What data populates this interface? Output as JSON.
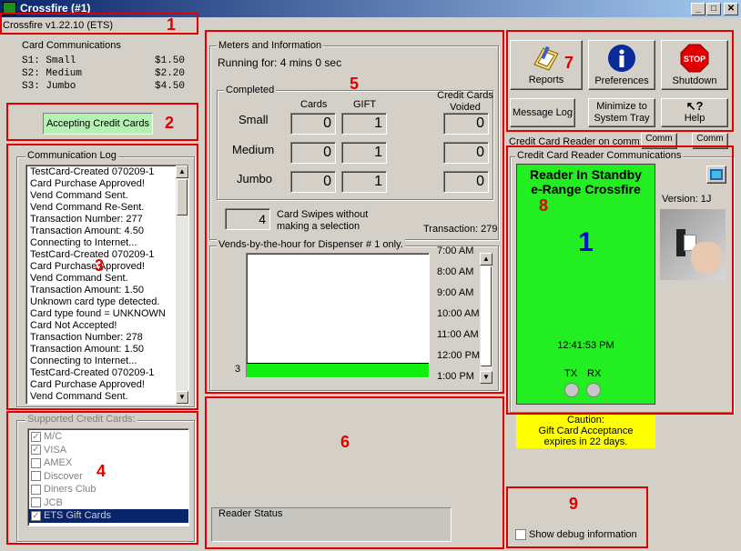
{
  "window": {
    "title": "Crossfire (#1)",
    "minimize": "_",
    "maximize": "□",
    "close": "✕"
  },
  "app_version": "Crossfire v1.22.10 (ETS)",
  "annotations": [
    "1",
    "2",
    "3",
    "4",
    "5",
    "6",
    "7",
    "8",
    "9"
  ],
  "card_comms": {
    "label": "Card Communications",
    "rows": [
      {
        "slot": "S1: Small",
        "price": "$1.50"
      },
      {
        "slot": "S2: Medium",
        "price": "$2.20"
      },
      {
        "slot": "S3: Jumbo",
        "price": "$4.50"
      }
    ]
  },
  "accepting_label": "Accepting Credit Cards",
  "comm_log": {
    "label": "Communication Log",
    "lines": [
      "TestCard-Created 070209-1",
      "Card Purchase Approved!",
      "Vend Command Sent.",
      "Vend Command Re-Sent.",
      "Transaction Number: 277",
      "Transaction Amount: 4.50",
      "Connecting to Internet...",
      "TestCard-Created 070209-1",
      "Card Purchase Approved!",
      "Vend Command Sent.",
      "Transaction Amount: 1.50",
      "Unknown card type detected.",
      "Card type found = UNKNOWN",
      "Card Not Accepted!",
      "Transaction Number: 278",
      "Transaction Amount: 1.50",
      "Connecting to Internet...",
      "TestCard-Created 070209-1",
      "Card Purchase Approved!",
      "Vend Command Sent."
    ]
  },
  "supported_cards": {
    "label": "Supported Credit Cards:",
    "items": [
      {
        "name": "M/C",
        "checked": "✓"
      },
      {
        "name": "VISA",
        "checked": "✓"
      },
      {
        "name": "AMEX",
        "checked": ""
      },
      {
        "name": "Discover",
        "checked": ""
      },
      {
        "name": "Diners Club",
        "checked": ""
      },
      {
        "name": "JCB",
        "checked": ""
      },
      {
        "name": "ETS Gift Cards",
        "checked": "✓"
      }
    ]
  },
  "meters": {
    "label": "Meters and Information",
    "running_for": "Running for: 4 mins 0 sec",
    "completed_label": "Completed",
    "col_cards": "Cards",
    "col_gift": "GIFT",
    "col_voided": "Credit Cards Voided",
    "rows": [
      {
        "name": "Small",
        "cards": "0",
        "gift": "1",
        "voided": "0"
      },
      {
        "name": "Medium",
        "cards": "0",
        "gift": "1",
        "voided": "0"
      },
      {
        "name": "Jumbo",
        "cards": "0",
        "gift": "1",
        "voided": "0"
      }
    ],
    "swipes_count": "4",
    "swipes_label_1": "Card Swipes without",
    "swipes_label_2": "making a selection",
    "transaction": "Transaction: 279"
  },
  "vends": {
    "label": "Vends-by-the-hour for Dispenser # 1 only.",
    "bar_label": "3",
    "bar_fill": 0.12,
    "hours": [
      "7:00 AM",
      "8:00 AM",
      "9:00 AM",
      "10:00 AM",
      "11:00 AM",
      "12:00 PM",
      "1:00 PM"
    ]
  },
  "reader_status_label": "Reader Status",
  "buttons": {
    "reports": "Reports",
    "preferences": "Preferences",
    "shutdown": "Shutdown",
    "message_log": "Message Log",
    "minimize_tray_1": "Minimize to",
    "minimize_tray_2": "System Tray",
    "help": "Help",
    "stop_text": "STOP"
  },
  "ccr_on_comm": "Credit Card Reader on comm:",
  "comm_btn_1": "Comm",
  "comm_btn_2": "Comm",
  "ccr": {
    "label": "Credit Card Reader Communications",
    "status_1": "Reader In Standby",
    "status_2": "e-Range Crossfire",
    "version": "Version: 1J",
    "big_number": "1",
    "time": "12:41:53 PM",
    "tx": "TX",
    "rx": "RX",
    "green": "#22ee22"
  },
  "caution": {
    "line1": "Caution:",
    "line2": "Gift Card Acceptance",
    "line3": "expires in 22 days."
  },
  "debug_label": "Show debug information"
}
